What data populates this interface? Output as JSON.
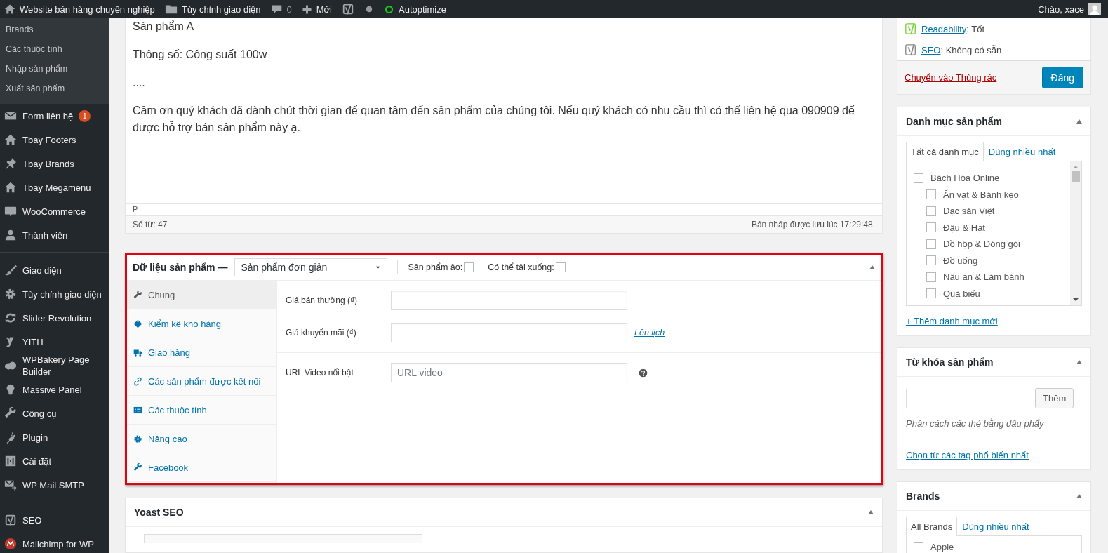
{
  "admin_bar": {
    "items": [
      {
        "kind": "site",
        "label": "Website bán hàng chuyên nghiệp"
      },
      {
        "kind": "customize",
        "label": "Tùy chỉnh giao diện"
      },
      {
        "kind": "comments",
        "label": "0"
      },
      {
        "kind": "new",
        "label": "Mới"
      },
      {
        "kind": "seo"
      },
      {
        "kind": "status"
      },
      {
        "kind": "optimize",
        "label": "Autoptimize"
      }
    ],
    "account": "Chào, xace"
  },
  "sidebar": {
    "submenu": [
      "Brands",
      "Các thuộc tính",
      "Nhập sản phẩm",
      "Xuất sản phẩm"
    ],
    "groups": [
      {
        "items": [
          {
            "label": "Form liên hệ",
            "badge": "1"
          },
          {
            "label": "Tbay Footers"
          },
          {
            "label": "Tbay Brands"
          },
          {
            "label": "Tbay Megamenu"
          },
          {
            "label": "WooCommerce"
          },
          {
            "label": "Thành viên"
          }
        ]
      },
      {
        "items": [
          {
            "label": "Giao diện"
          },
          {
            "label": "Tùy chỉnh giao diện"
          },
          {
            "label": "Slider Revolution"
          },
          {
            "label": "YITH"
          },
          {
            "label": "WPBakery Page Builder"
          },
          {
            "label": "Massive Panel"
          },
          {
            "label": "Công cụ"
          },
          {
            "label": "Plugin"
          },
          {
            "label": "Cài đặt"
          },
          {
            "label": "WP Mail SMTP"
          }
        ]
      },
      {
        "items": [
          {
            "label": "SEO"
          },
          {
            "label": "Mailchimp for WP"
          }
        ]
      }
    ]
  },
  "editor": {
    "paragraphs": [
      "Sản phẩm A",
      "Thông số: Công suất 100w",
      "....",
      "Cảm ơn quý khách đã dành chút thời gian để quan tâm đến sản phẩm của chúng tôi. Nếu quý khách có nhu cầu thì có thể liên hệ qua 090909 để được hỗ trợ bán sản phẩm này ạ."
    ],
    "path": "P",
    "word_count": "Số từ: 47",
    "saved": "Bản nháp được lưu lúc 17:29:48."
  },
  "product_data": {
    "highlighted": true,
    "title": "Dữ liệu sản phẩm —",
    "type_select": "Sản phẩm đơn giản",
    "options": [
      {
        "label": "Sản phẩm ảo:",
        "checked": false
      },
      {
        "label": "Có thể tải xuống:",
        "checked": false
      }
    ],
    "tabs": [
      {
        "label": "Chung",
        "selected": true
      },
      {
        "label": "Kiểm kê kho hàng",
        "selected": false
      },
      {
        "label": "Giao hàng",
        "selected": false
      },
      {
        "label": "Các sản phẩm được kết nối",
        "selected": false
      },
      {
        "label": "Các thuộc tính",
        "selected": false
      },
      {
        "label": "Nâng cao",
        "selected": false
      },
      {
        "label": "Facebook",
        "selected": false
      }
    ],
    "field_groups": [
      {
        "fields": [
          {
            "label": "Giá bán thường (₫)",
            "help": false
          },
          {
            "label": "Giá khuyến mãi (₫)",
            "link": "Lên lịch",
            "help": false
          }
        ]
      },
      {
        "fields": [
          {
            "label": "URL Video nổi bật",
            "placeholder": "URL video",
            "help": true
          }
        ]
      }
    ]
  },
  "yoast_box": {
    "title": "Yoast SEO"
  },
  "publish": {
    "scores": [
      {
        "link": "Readability",
        "value": ": Tốt",
        "good": true
      },
      {
        "link": "SEO",
        "value": ": Không có sẵn",
        "good": false
      }
    ],
    "trash": "Chuyển vào Thùng rác",
    "publish_button": "Đăng"
  },
  "categories": {
    "title": "Danh mục sản phẩm",
    "tabs": [
      {
        "label": "Tất cả danh mục",
        "selected": true
      },
      {
        "label": "Dùng nhiều nhất",
        "selected": false
      }
    ],
    "tree": [
      {
        "label": "Bách Hóa Online",
        "checked": false,
        "children": [
          {
            "label": "Ăn vặt & Bánh kẹo",
            "checked": false
          },
          {
            "label": "Đặc sản Việt",
            "checked": false
          },
          {
            "label": "Đậu & Hạt",
            "checked": false
          },
          {
            "label": "Đồ hộp & Đóng gói",
            "checked": false
          },
          {
            "label": "Đồ uống",
            "checked": false
          },
          {
            "label": "Nấu ăn & Làm bánh",
            "checked": false
          },
          {
            "label": "Quà biếu",
            "checked": false
          }
        ]
      }
    ],
    "add_link": "+ Thêm danh mục mới"
  },
  "tags": {
    "title": "Từ khóa sản phẩm",
    "add_button": "Thêm",
    "hint": "Phân cách các thẻ bằng dấu phẩy",
    "link": "Chọn từ các tag phổ biến nhất"
  },
  "brands": {
    "title": "Brands",
    "tabs": [
      {
        "label": "All Brands",
        "selected": true
      },
      {
        "label": "Dùng nhiều nhất",
        "selected": false
      }
    ],
    "items": [
      {
        "label": "Apple",
        "checked": false
      }
    ]
  }
}
